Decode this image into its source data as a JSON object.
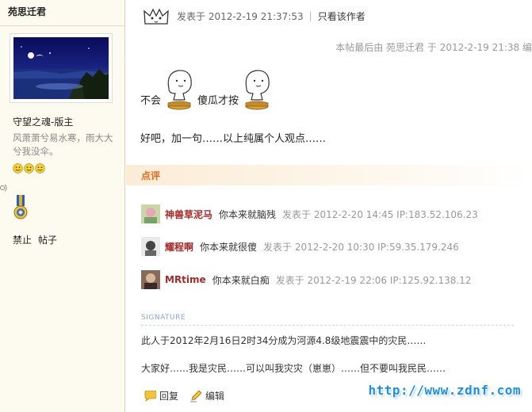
{
  "author": {
    "name": "苑思迁君",
    "title": "守望之魂-版主",
    "signature": "风萧萧兮易水寒，雨大大兮我没伞。",
    "actions": [
      "禁止",
      "帖子"
    ]
  },
  "post": {
    "posted_label": "发表于 2012-2-19 21:37:53",
    "only_author": "只看该作者",
    "last_edit": "本帖最后由 苑思迁君 于 2012-2-19 21:38 编",
    "line1_a": "不会",
    "line1_b": "傻瓜才按",
    "line2": "好吧，加一句……以上纯属个人观点……"
  },
  "comments": {
    "header": "点评",
    "items": [
      {
        "user": "神兽草泥马",
        "text": "你本来就脑残",
        "meta": "发表于 2012-2-20 14:45 IP:183.52.106.23"
      },
      {
        "user": "耀程啊",
        "text": "你本来就很傻",
        "meta": "发表于 2012-2-20 10:30 IP:59.35.179.246"
      },
      {
        "user": "MRtime",
        "text": "你本来就白痴",
        "meta": "发表于 2012-2-19 22:06 IP:125.92.138.12"
      }
    ]
  },
  "signature": {
    "label": "SIGNATURE",
    "line1": "此人于2012年2月16日2时34分成为河源4.8级地震震中的灾民……",
    "line2": "大家好……我是灾民……可以叫我灾灾（崽崽）……但不要叫我民民……"
  },
  "actions": {
    "reply": "回复",
    "edit": "编辑"
  },
  "watermark": "http://www.zdnf.com",
  "colors": {
    "sidebar_bg": "#fdfbf0",
    "comment_header": "#e06a1b",
    "commenter_name": "#a52a2a",
    "watermark": "#1e8fe0"
  }
}
